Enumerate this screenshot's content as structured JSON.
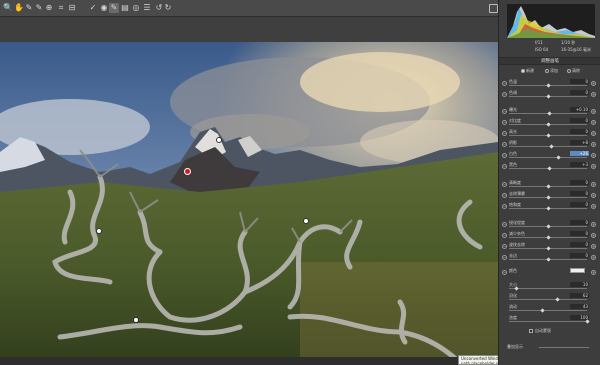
{
  "toolbar": {
    "tools": [
      {
        "name": "zoom-tool-icon",
        "glyph": "🔍"
      },
      {
        "name": "hand-tool-icon",
        "glyph": "✋"
      },
      {
        "name": "white-balance-icon",
        "glyph": "✎"
      },
      {
        "name": "color-sampler-icon",
        "glyph": "✎"
      },
      {
        "name": "targeted-adjustment-icon",
        "glyph": "⊕"
      },
      {
        "name": "crop-tool-icon",
        "glyph": "⌗"
      },
      {
        "name": "straighten-tool-icon",
        "glyph": "⊟"
      },
      {
        "name": "spot-removal-icon",
        "glyph": "✓"
      },
      {
        "name": "red-eye-icon",
        "glyph": "◉"
      },
      {
        "name": "adjustment-brush-icon",
        "glyph": "✎"
      },
      {
        "name": "graduated-filter-icon",
        "glyph": "▤"
      },
      {
        "name": "radial-filter-icon",
        "glyph": "◎"
      },
      {
        "name": "preferences-icon",
        "glyph": "☰"
      },
      {
        "name": "rotate-ccw-icon",
        "glyph": "↺"
      },
      {
        "name": "rotate-cw-icon",
        "glyph": "↻"
      }
    ],
    "export_icon": "export-icon"
  },
  "camera_info": {
    "aperture": "f/11",
    "shutter": "1/10 秒",
    "iso": "ISO 64",
    "lens": "16-35@16 毫米"
  },
  "panel": {
    "title": "调整画笔",
    "modes": [
      {
        "label": "新建",
        "selected": true
      },
      {
        "label": "添加",
        "selected": false
      },
      {
        "label": "清除",
        "selected": false
      }
    ]
  },
  "adjustments": [
    {
      "label": "色温",
      "value": "0",
      "pos": 0.5,
      "selected": false
    },
    {
      "label": "色调",
      "value": "0",
      "pos": 0.5,
      "selected": false
    },
    {
      "label": "曝光",
      "value": "+0.10",
      "pos": 0.52,
      "selected": false
    },
    {
      "label": "对比度",
      "value": "0",
      "pos": 0.5,
      "selected": false
    },
    {
      "label": "高光",
      "value": "0",
      "pos": 0.5,
      "selected": false
    },
    {
      "label": "阴影",
      "value": "+8",
      "pos": 0.54,
      "selected": false
    },
    {
      "label": "白色",
      "value": "+26",
      "pos": 0.63,
      "selected": true
    },
    {
      "label": "黑色",
      "value": "+3",
      "pos": 0.52,
      "selected": false
    },
    {
      "label": "清晰度",
      "value": "0",
      "pos": 0.5,
      "selected": false
    },
    {
      "label": "去除薄雾",
      "value": "0",
      "pos": 0.5,
      "selected": false
    },
    {
      "label": "饱和度",
      "value": "0",
      "pos": 0.5,
      "selected": false
    },
    {
      "label": "锐化程度",
      "value": "0",
      "pos": 0.5,
      "selected": false
    },
    {
      "label": "减少杂色",
      "value": "0",
      "pos": 0.5,
      "selected": false
    },
    {
      "label": "波纹去除",
      "value": "0",
      "pos": 0.5,
      "selected": false
    },
    {
      "label": "去边",
      "value": "0",
      "pos": 0.5,
      "selected": false
    }
  ],
  "color": {
    "label": "颜色",
    "swatch": "#f0f0f0"
  },
  "brush": [
    {
      "label": "大小",
      "value": "10",
      "pos": 0.1
    },
    {
      "label": "羽化",
      "value": "62",
      "pos": 0.62
    },
    {
      "label": "流动",
      "value": "43",
      "pos": 0.43
    },
    {
      "label": "浓度",
      "value": "100",
      "pos": 1.0
    }
  ],
  "auto_mask": {
    "label": "自动蒙版",
    "checked": false
  },
  "overlay": {
    "label": "叠加显示"
  },
  "tooltip": "Unconverted Windows path placeholder 中文 显示"
}
